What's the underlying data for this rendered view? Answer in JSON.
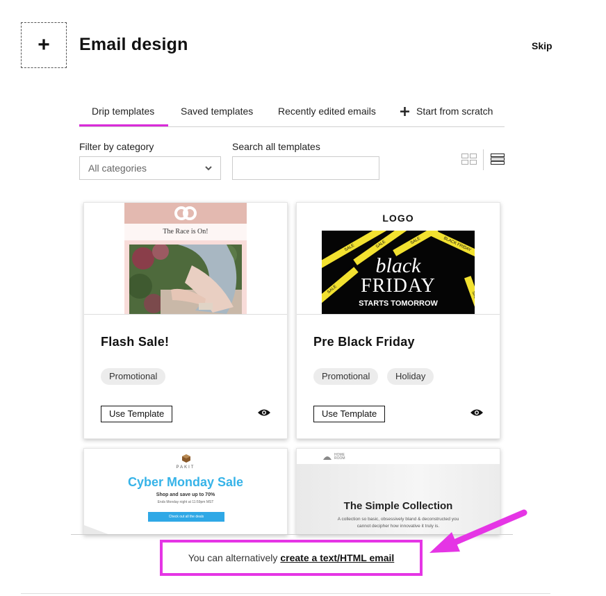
{
  "header": {
    "add_symbol": "+",
    "title": "Email design",
    "skip_label": "Skip"
  },
  "tabs": [
    {
      "label": "Drip templates",
      "active": true
    },
    {
      "label": "Saved templates"
    },
    {
      "label": "Recently edited emails"
    },
    {
      "label": "Start from scratch",
      "icon": "plus-icon"
    }
  ],
  "filters": {
    "category_label": "Filter by category",
    "category_value": "All categories",
    "search_label": "Search all templates",
    "search_placeholder": ""
  },
  "accent_color": "#d92bd9",
  "cards": [
    {
      "title": "Flash Sale!",
      "tags": [
        "Promotional"
      ],
      "use_label": "Use Template",
      "preview": {
        "headline": "The Race is On!"
      }
    },
    {
      "title": "Pre Black Friday",
      "tags": [
        "Promotional",
        "Holiday"
      ],
      "use_label": "Use Template",
      "preview": {
        "logo": "LOGO",
        "line1": "black",
        "line2": "FRIDAY",
        "line3": "STARTS TOMORROW",
        "tape_text": "SALE",
        "tape_text2": "BLACK FRIDAY"
      }
    },
    {
      "preview": {
        "brand": "PAKIT",
        "headline": "Cyber Monday Sale",
        "sub": "Shop and save up to 70%",
        "small": "Ends Monday night at 11:59pm MST",
        "button": "Check out all the deals"
      }
    },
    {
      "preview": {
        "brand1": "HOME",
        "brand2": "ROOM",
        "headline": "The Simple Collection",
        "line1": "A collection so basic, obsessively bland & deconstructed you",
        "line2": "cannot decipher how innovative it truly is."
      }
    }
  ],
  "footer": {
    "text": "You can alternatively",
    "link": "create a text/HTML email"
  }
}
